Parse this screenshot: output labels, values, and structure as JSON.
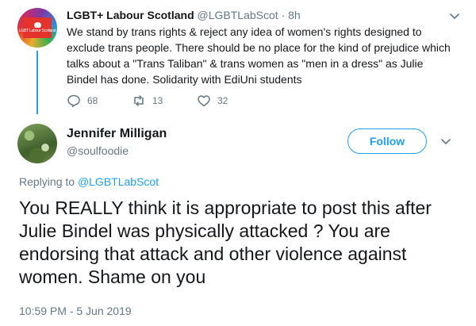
{
  "parent_tweet": {
    "author_name": "LGBT+ Labour Scotland",
    "author_handle": "@LGBTLabScot",
    "separator": "·",
    "time_ago": "8h",
    "avatar_text": "LGBT Labour Scotland",
    "text": "We stand by trans rights & reject any idea of women's rights designed to exclude trans people. There should be no place for the kind of prejudice which talks about a \"Trans Taliban\" & trans women as \"men in a dress\" as Julie Bindel has done. Solidarity with EdiUni students",
    "reply_count": "68",
    "retweet_count": "13",
    "like_count": "32"
  },
  "main_tweet": {
    "author_name": "Jennifer Milligan",
    "author_handle": "@soulfoodie",
    "follow_label": "Follow",
    "replying_to_prefix": "Replying to",
    "replying_to_handle": "@LGBTLabScot",
    "text": "You REALLY think it is appropriate to post this after Julie Bindel was physically attacked ? You are endorsing that attack and other violence against women. Shame on you",
    "timestamp": "10:59 PM - 5 Jun 2019"
  },
  "colors": {
    "accent": "#1da1f2",
    "text": "#14171a",
    "muted": "#657786",
    "labour_red": "#e4322c"
  },
  "icons": [
    "reply-icon",
    "retweet-icon",
    "like-icon",
    "chevron-down-icon"
  ]
}
